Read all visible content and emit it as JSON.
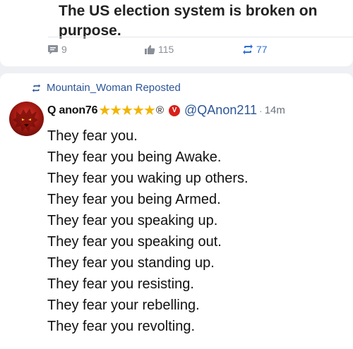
{
  "quoted_post": {
    "text": "The US election system is broken on purpose.",
    "comments": "9",
    "likes": "115",
    "reposts": "77"
  },
  "repost_header": {
    "label": "Mountain_Woman Reposted"
  },
  "post": {
    "author_name": "Q anon76",
    "stars": "★★★★★",
    "registered": "®",
    "handle": "@QAnon211",
    "separator": "·",
    "time": "14m",
    "lines": [
      "They fear you.",
      "They fear you being Awake.",
      "They fear you waking up others.",
      "They fear you being Armed.",
      "They fear you speaking up.",
      "They fear you speaking out.",
      "They fear you standing up.",
      "They fear you resisting.",
      "They fear your rebelling.",
      "They fear you revolting."
    ]
  },
  "colors": {
    "link": "#2b5597",
    "repost_active": "#2b6fd6",
    "verified": "#d8211a",
    "stars": "#f2b400"
  },
  "icons": {
    "comments": "comment-icon",
    "likes": "thumbs-up-icon",
    "reposts": "repost-icon"
  }
}
